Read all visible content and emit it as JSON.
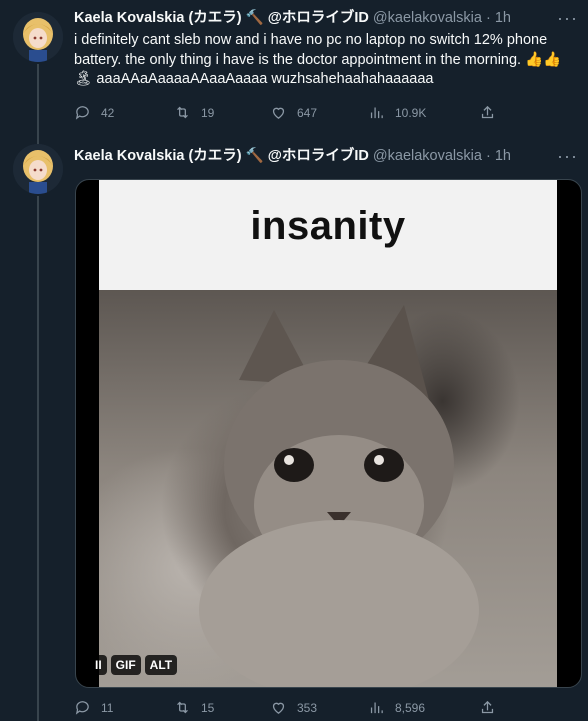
{
  "tweets": [
    {
      "name": "Kaela Kovalskia (カエラ) 🔨 @ホロライブID",
      "handle": "@kaelakovalskia",
      "time": "1h",
      "text": "i definitely cant sleb now and i have no pc no laptop no switch 12% phone battery. the only thing i have is the doctor appointment in the morning. 👍👍🏝 aaaAAaAaaaaAAaaAaaaa wuzhsahehaahahaaaaaa",
      "replies": "42",
      "retweets": "19",
      "likes": "647",
      "views": "10.9K"
    },
    {
      "name": "Kaela Kovalskia (カエラ) 🔨 @ホロライブID",
      "handle": "@kaelakovalskia",
      "time": "1h",
      "gif_caption": "insanity",
      "pause_label": "II",
      "gif_label": "GIF",
      "alt_label": "ALT",
      "replies": "11",
      "retweets": "15",
      "likes": "353",
      "views": "8,596"
    }
  ],
  "separator": "·",
  "more": "···"
}
